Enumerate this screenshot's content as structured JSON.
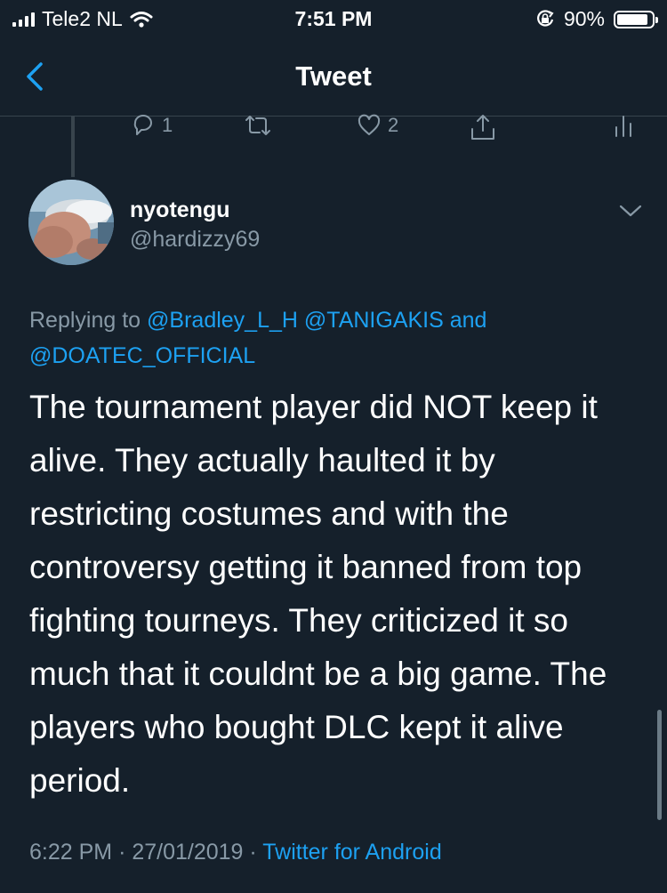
{
  "status_bar": {
    "carrier": "Tele2 NL",
    "time": "7:51 PM",
    "battery": "90%",
    "battery_level": 0.9,
    "icons": [
      "signal-icon",
      "wifi-icon",
      "orientation-lock-icon",
      "battery-icon"
    ]
  },
  "nav": {
    "title": "Tweet",
    "back_icon": "chevron-left-icon"
  },
  "previous_tweet_actions": {
    "reply_count": "1",
    "retweet_count": "",
    "like_count": "2"
  },
  "tweet": {
    "display_name": "nyotengu",
    "handle": "@hardizzy69",
    "replying_prefix": "Replying to",
    "mention_1": "@Bradley_L_H",
    "mention_2": "@TANIGAKIS",
    "and_word": "and",
    "mention_3": "@DOATEC_OFFICIAL",
    "text": "The tournament player did NOT keep it alive. They actually haulted it by restricting costumes and with the controversy getting it banned from top fighting tourneys. They criticized it so much that it couldnt be a big game. The players who bought DLC kept it alive period.",
    "time": "6:22 PM",
    "date": "27/01/2019",
    "separator": "·",
    "source": "Twitter for Android"
  },
  "colors": {
    "background": "#15202b",
    "secondary_text": "#8899a6",
    "link": "#1da1f2",
    "divider": "#38444d"
  }
}
